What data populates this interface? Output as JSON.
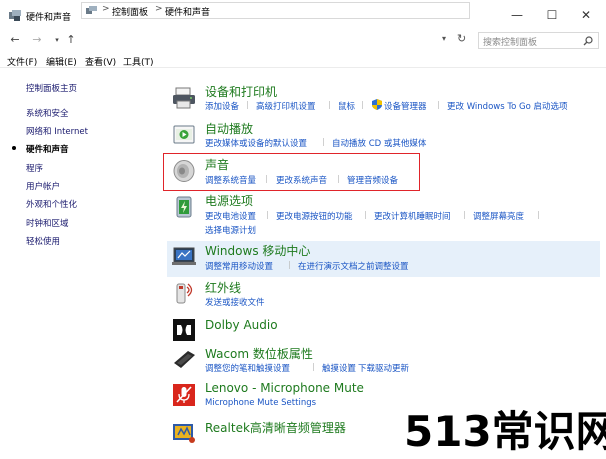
{
  "window": {
    "title": "硬件和声音",
    "minimize": "—",
    "maximize": "☐",
    "close": "✕"
  },
  "address": {
    "crumb1": "控制面板",
    "crumb2": "硬件和声音",
    "separator": ">",
    "search_placeholder": "搜索控制面板"
  },
  "menu": {
    "file": "文件(F)",
    "edit": "编辑(E)",
    "view": "查看(V)",
    "tools": "工具(T)"
  },
  "sidebar": {
    "items": [
      "控制面板主页",
      "系统和安全",
      "网络和 Internet",
      "硬件和声音",
      "程序",
      "用户帐户",
      "外观和个性化",
      "时钟和区域",
      "轻松使用"
    ]
  },
  "categories": {
    "devices": {
      "title": "设备和打印机",
      "links": [
        "添加设备",
        "高级打印机设置",
        "鼠标",
        "设备管理器",
        "更改 Windows To Go 启动选项"
      ]
    },
    "autoplay": {
      "title": "自动播放",
      "links": [
        "更改媒体或设备的默认设置",
        "自动播放 CD 或其他媒体"
      ]
    },
    "sound": {
      "title": "声音",
      "links": [
        "调整系统音量",
        "更改系统声音",
        "管理音频设备"
      ]
    },
    "power": {
      "title": "电源选项",
      "links": [
        "更改电池设置",
        "更改电源按钮的功能",
        "更改计算机睡眠时间",
        "调整屏幕亮度",
        "选择电源计划"
      ]
    },
    "mobility": {
      "title": "Windows 移动中心",
      "links": [
        "调整常用移动设置",
        "在进行演示文档之前调整设置"
      ]
    },
    "infrared": {
      "title": "红外线",
      "links": [
        "发送或接收文件"
      ]
    },
    "dolby": {
      "title": "Dolby Audio",
      "links": []
    },
    "wacom": {
      "title": "Wacom 数位板属性",
      "links": [
        "调整您的笔和触摸设置",
        "触摸设置",
        "下载驱动更新"
      ]
    },
    "lenovo": {
      "title": "Lenovo - Microphone Mute",
      "links": [
        "Microphone Mute Settings"
      ]
    },
    "realtek": {
      "title": "Realtek高清晰音频管理器",
      "links": []
    }
  },
  "watermark": "513常识网",
  "colors": {
    "category_title": "#1e7a1e",
    "link": "#1a55c4",
    "highlight_row": "#e6f0fa",
    "annotation_box": "#e0242a"
  }
}
